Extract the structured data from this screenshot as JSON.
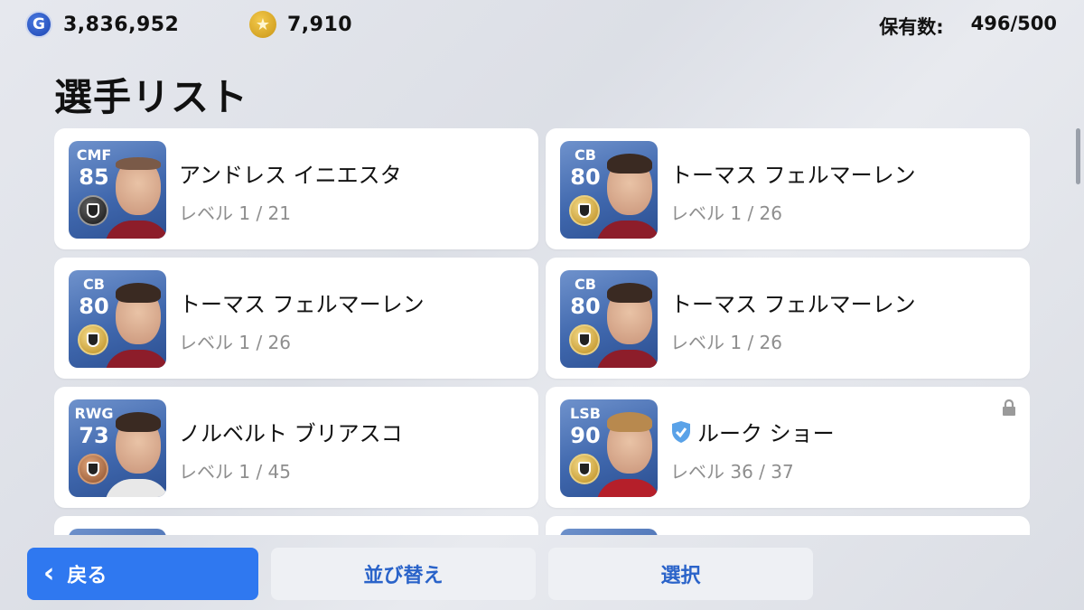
{
  "currencies": {
    "gp": {
      "icon": "g-coin-icon",
      "glyph": "G",
      "amount": "3,836,952"
    },
    "coins": {
      "icon": "star-coin-icon",
      "glyph": "★",
      "amount": "7,910"
    }
  },
  "capacity": {
    "label": "保有数:",
    "value": "496/500"
  },
  "page_title": "選手リスト",
  "players": [
    {
      "position": "CMF",
      "rating": "85",
      "name": "アンドレス イニエスタ",
      "level": "レベル 1 / 21",
      "badge": "black",
      "verified": false,
      "locked": false
    },
    {
      "position": "CB",
      "rating": "80",
      "name": "トーマス フェルマーレン",
      "level": "レベル 1 / 26",
      "badge": "gold",
      "verified": false,
      "locked": false
    },
    {
      "position": "CB",
      "rating": "80",
      "name": "トーマス フェルマーレン",
      "level": "レベル 1 / 26",
      "badge": "gold",
      "verified": false,
      "locked": false
    },
    {
      "position": "CB",
      "rating": "80",
      "name": "トーマス フェルマーレン",
      "level": "レベル 1 / 26",
      "badge": "gold",
      "verified": false,
      "locked": false
    },
    {
      "position": "RWG",
      "rating": "73",
      "name": "ノルベルト ブリアスコ",
      "level": "レベル 1 / 45",
      "badge": "bronze",
      "verified": false,
      "locked": false
    },
    {
      "position": "LSB",
      "rating": "90",
      "name": "ルーク ショー",
      "level": "レベル 36 / 37",
      "badge": "gold",
      "verified": true,
      "locked": true
    }
  ],
  "buttons": {
    "back": "戻る",
    "sort": "並び替え",
    "select": "選択"
  },
  "colors": {
    "primary_blue": "#2f78f0",
    "button_text_blue": "#2a63c9",
    "card_bg": "#ffffff",
    "level_gray": "#8e8e8e"
  }
}
